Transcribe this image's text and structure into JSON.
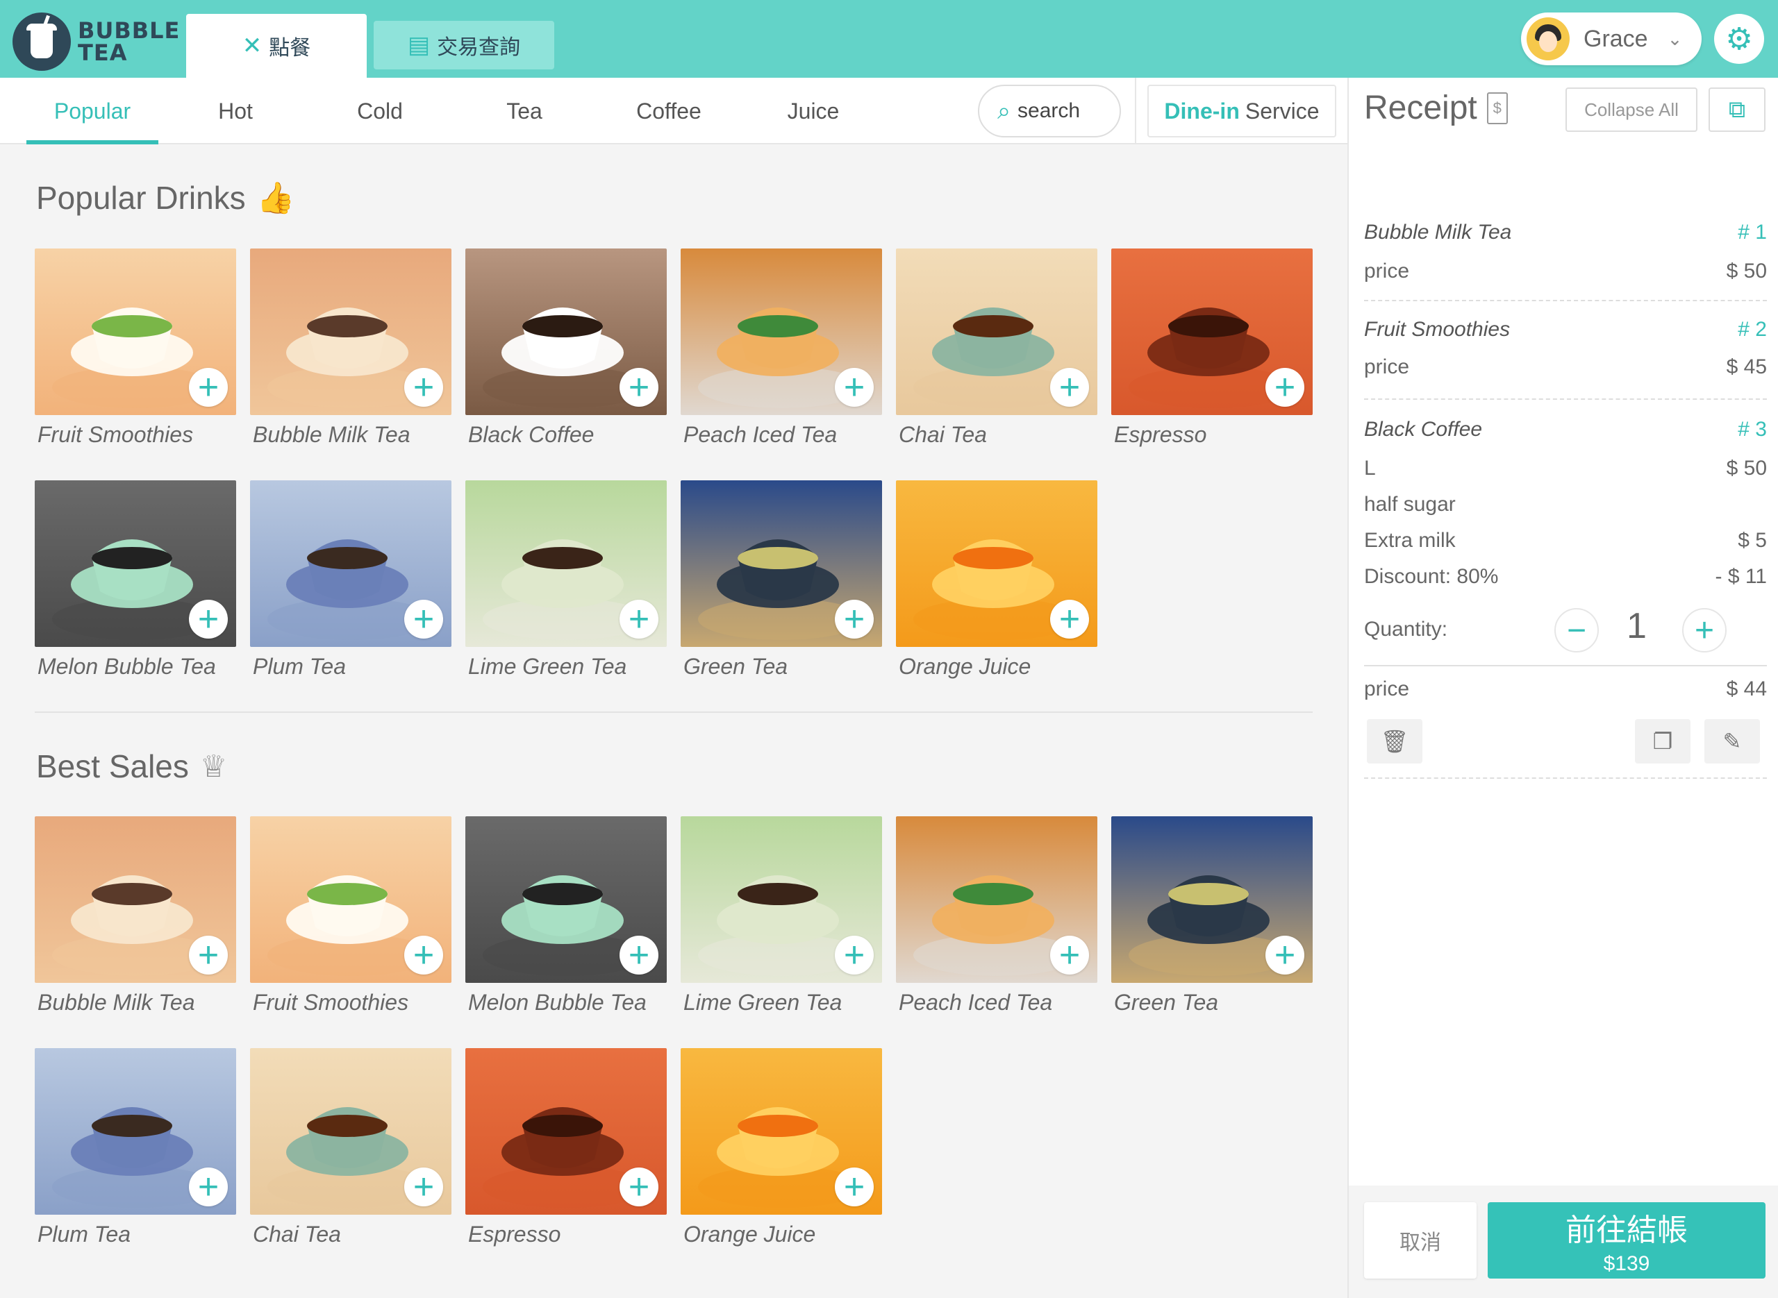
{
  "brand": {
    "line1": "BUBBLE",
    "line2": "TEA"
  },
  "main_tabs": [
    {
      "label": "點餐",
      "icon": "utensils-icon"
    },
    {
      "label": "交易查詢",
      "icon": "list-icon"
    }
  ],
  "user": {
    "name": "Grace"
  },
  "categories": [
    "Popular",
    "Hot",
    "Cold",
    "Tea",
    "Coffee",
    "Juice"
  ],
  "search": {
    "label": "search"
  },
  "dine_in": {
    "strong": "Dine-in",
    "rest": "Service"
  },
  "popular": {
    "title": "Popular Drinks",
    "items": [
      "Fruit Smoothies",
      "Bubble Milk Tea",
      "Black Coffee",
      "Peach Iced Tea",
      "Chai Tea",
      "Espresso",
      "Melon Bubble Tea",
      "Plum Tea",
      "Lime Green Tea",
      "Green Tea",
      "Orange Juice"
    ]
  },
  "best": {
    "title": "Best Sales",
    "items": [
      "Bubble Milk Tea",
      "Fruit Smoothies",
      "Melon Bubble Tea",
      "Lime Green Tea",
      "Peach Iced Tea",
      "Green Tea",
      "Plum Tea",
      "Chai Tea",
      "Espresso",
      "Orange Juice"
    ]
  },
  "receipt": {
    "title": "Receipt",
    "icon_glyph": "$",
    "collapse_label": "Collapse All",
    "items": [
      {
        "name": "Bubble Milk Tea",
        "num": "# 1",
        "price_label": "price",
        "price": "$ 50"
      },
      {
        "name": "Fruit Smoothies",
        "num": "# 2",
        "price_label": "price",
        "price": "$ 45"
      },
      {
        "name": "Black Coffee",
        "num": "# 3",
        "size": "L",
        "size_price": "$ 50",
        "sugar": "half sugar",
        "extra": "Extra milk",
        "extra_price": "$ 5",
        "discount": "Discount: 80%",
        "discount_price": "- $ 11",
        "quantity_label": "Quantity:",
        "quantity": "1",
        "price_label": "price",
        "price": "$ 44"
      }
    ],
    "cancel_label": "取消",
    "checkout_label": "前往結帳",
    "total": "$139"
  },
  "colors": {
    "accent": "#35bfb7",
    "header": "#63d3c8"
  }
}
